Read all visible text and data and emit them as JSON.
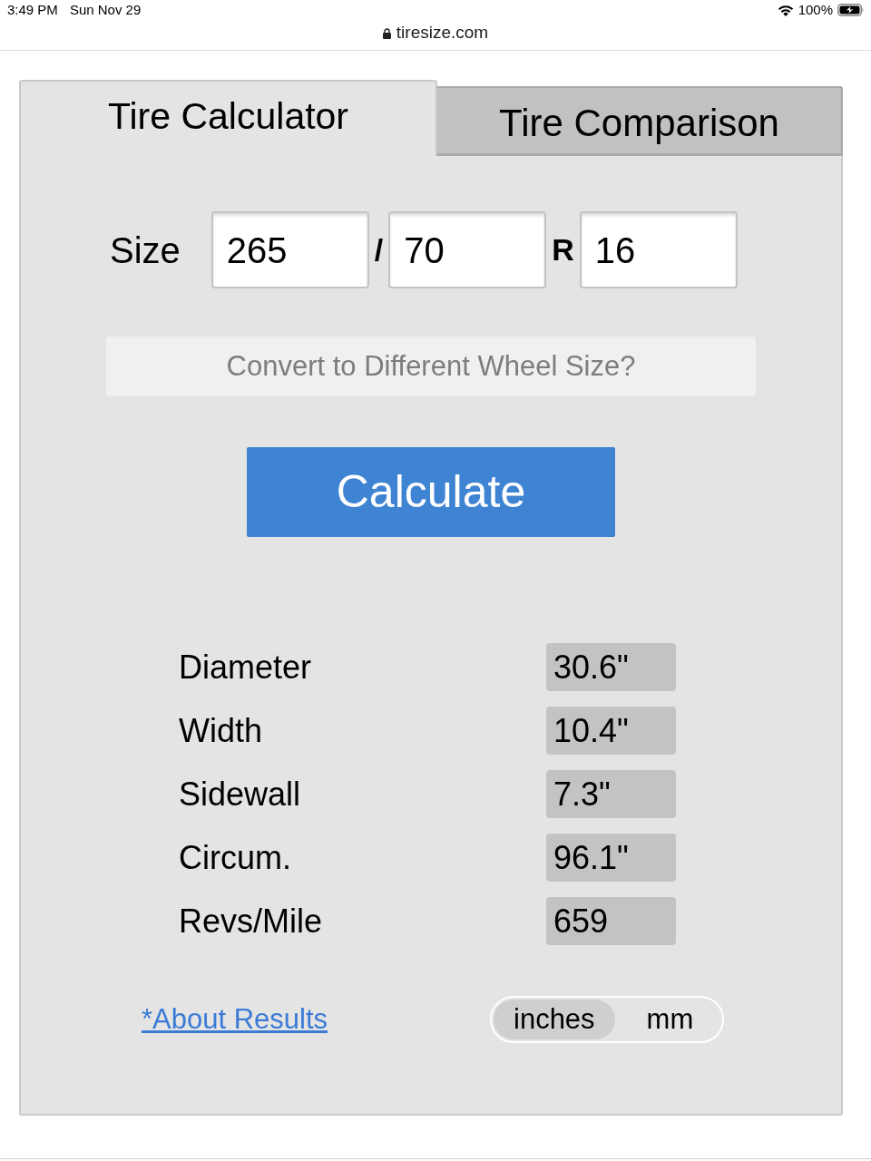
{
  "status_bar": {
    "time": "3:49 PM",
    "date": "Sun Nov 29",
    "battery": "100%"
  },
  "address_bar": {
    "url": "tiresize.com"
  },
  "tabs": [
    {
      "label": "Tire Calculator",
      "selected": true
    },
    {
      "label": "Tire Comparison",
      "selected": false
    }
  ],
  "size": {
    "label": "Size",
    "parts": [
      {
        "value": "265"
      },
      {
        "separator": "/",
        "value": "70"
      },
      {
        "separator": "R",
        "value": "16"
      }
    ]
  },
  "convert_button": {
    "label": "Convert to Different Wheel Size?"
  },
  "calculate_button": {
    "label": "Calculate"
  },
  "results": [
    {
      "label": "Diameter",
      "value": "30.6\""
    },
    {
      "label": "Width",
      "value": "10.4\""
    },
    {
      "label": "Sidewall",
      "value": "7.3\""
    },
    {
      "label": "Circum.",
      "value": "96.1\""
    },
    {
      "label": "Revs/Mile",
      "value": "659"
    }
  ],
  "about_link": {
    "label": "*About Results"
  },
  "units": [
    {
      "label": "inches",
      "selected": true
    },
    {
      "label": "mm",
      "selected": false
    }
  ]
}
